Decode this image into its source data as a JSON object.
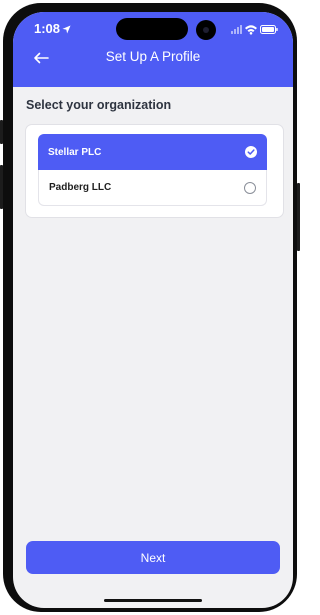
{
  "status_bar": {
    "time": "1:08"
  },
  "header": {
    "title": "Set Up A Profile"
  },
  "section": {
    "title": "Select your organization"
  },
  "organizations": [
    {
      "label": "Stellar PLC",
      "selected": true
    },
    {
      "label": "Padberg LLC",
      "selected": false
    }
  ],
  "footer": {
    "next_label": "Next"
  },
  "colors": {
    "accent": "#4e5cf4",
    "background": "#f1f1f3"
  }
}
